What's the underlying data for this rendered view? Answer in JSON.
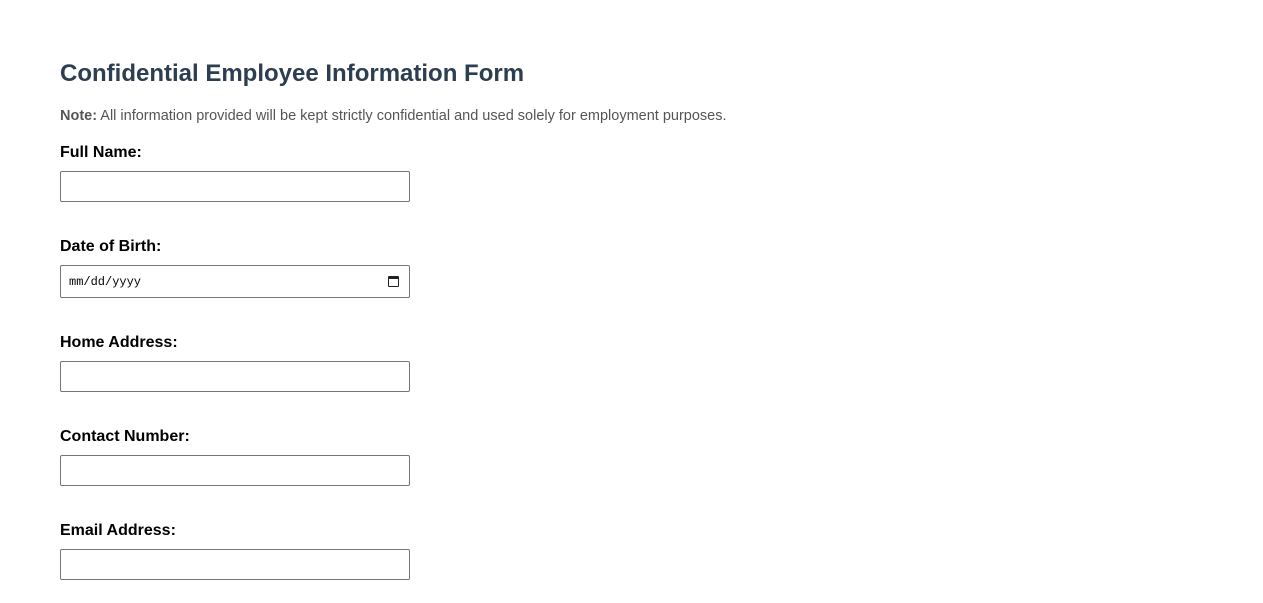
{
  "form": {
    "title": "Confidential Employee Information Form",
    "note_label": "Note:",
    "note_text": " All information provided will be kept strictly confidential and used solely for employment purposes.",
    "fields": [
      {
        "label": "Full Name:",
        "value": "",
        "type": "text"
      },
      {
        "label": "Date of Birth:",
        "placeholder": "mm/dd/yyyy",
        "type": "date"
      },
      {
        "label": "Home Address:",
        "value": "",
        "type": "text"
      },
      {
        "label": "Contact Number:",
        "value": "",
        "type": "text"
      },
      {
        "label": "Email Address:",
        "value": "",
        "type": "text"
      }
    ]
  }
}
